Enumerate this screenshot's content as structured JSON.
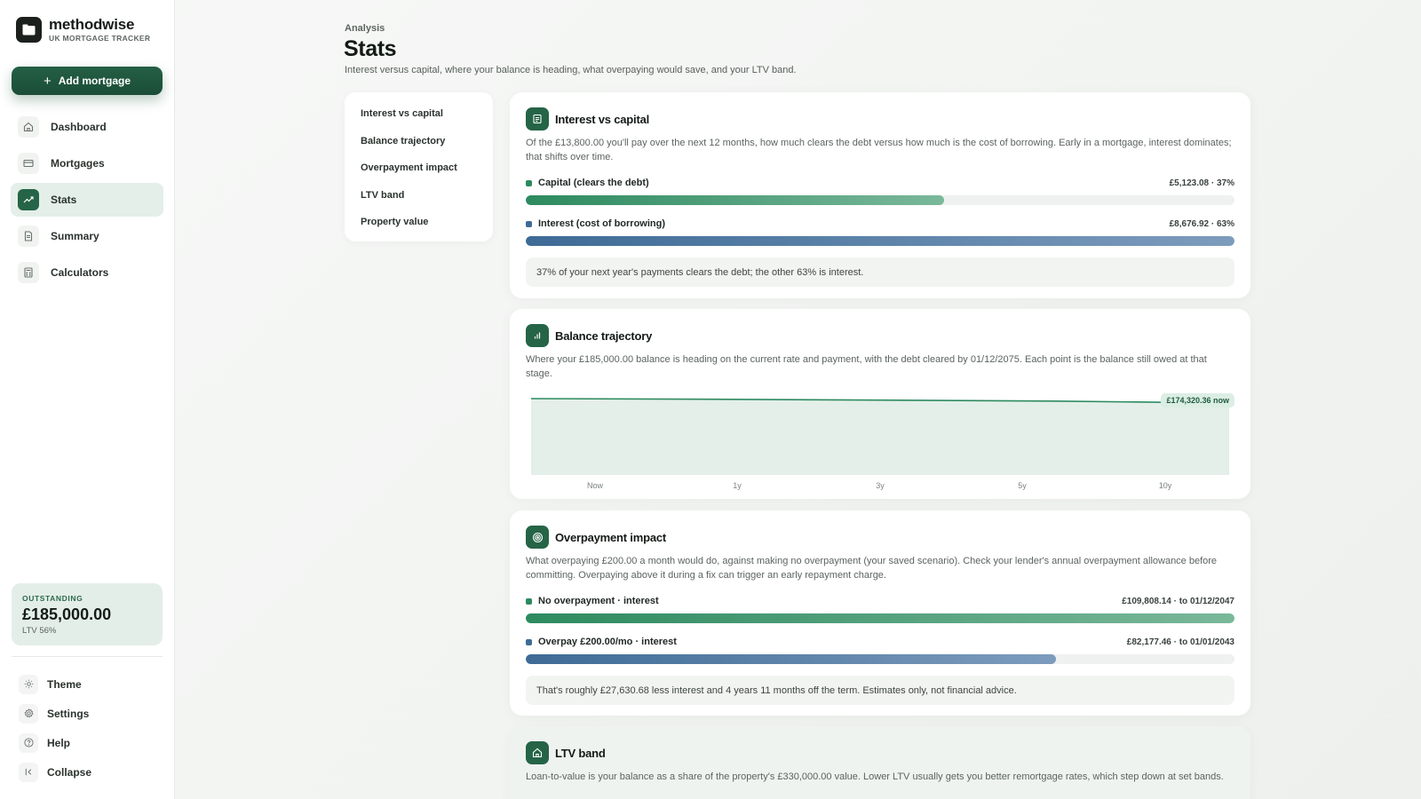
{
  "brand": {
    "name": "methodwise",
    "subtitle": "UK MORTGAGE TRACKER"
  },
  "sidebar": {
    "add_button": "Add mortgage",
    "nav": [
      {
        "label": "Dashboard",
        "icon": "home-icon"
      },
      {
        "label": "Mortgages",
        "icon": "card-icon"
      },
      {
        "label": "Stats",
        "icon": "trend-icon",
        "active": true
      },
      {
        "label": "Summary",
        "icon": "document-icon"
      },
      {
        "label": "Calculators",
        "icon": "calculator-icon"
      }
    ],
    "outstanding": {
      "label": "OUTSTANDING",
      "value": "£185,000.00",
      "ltv": "LTV 56%"
    },
    "footer": [
      {
        "label": "Theme",
        "icon": "sun-icon"
      },
      {
        "label": "Settings",
        "icon": "gear-icon"
      },
      {
        "label": "Help",
        "icon": "help-icon"
      },
      {
        "label": "Collapse",
        "icon": "collapse-icon"
      }
    ]
  },
  "header": {
    "eyebrow": "Analysis",
    "title": "Stats",
    "description": "Interest versus capital, where your balance is heading, what overpaying would save, and your LTV band."
  },
  "section_nav": [
    "Interest vs capital",
    "Balance trajectory",
    "Overpayment impact",
    "LTV band",
    "Property value"
  ],
  "interest_vs_capital": {
    "title": "Interest vs capital",
    "description": "Of the £13,800.00 you'll pay over the next 12 months, how much clears the debt versus how much is the cost of borrowing. Early in a mortgage, interest dominates; that shifts over time.",
    "capital": {
      "label": "Capital (clears the debt)",
      "value": "£5,123.08 · 37%",
      "percent": 37
    },
    "interest": {
      "label": "Interest (cost of borrowing)",
      "value": "£8,676.92 · 63%",
      "percent": 63
    },
    "note": "37% of your next year's payments clears the debt; the other 63% is interest."
  },
  "balance_trajectory": {
    "title": "Balance trajectory",
    "description": "Where your £185,000.00 balance is heading on the current rate and payment, with the debt cleared by 01/12/2075. Each point is the balance still owed at that stage.",
    "badge": "£174,320.36 now"
  },
  "chart_data": {
    "type": "area",
    "categories": [
      "Now",
      "1y",
      "3y",
      "5y",
      "10y"
    ],
    "values": [
      185000,
      183500,
      181500,
      179000,
      174320.36
    ],
    "title": "",
    "xlabel": "",
    "ylabel": "",
    "grid": false,
    "colors": {
      "line": "#2d8a5f",
      "fill": "#e3efe8"
    }
  },
  "overpayment_impact": {
    "title": "Overpayment impact",
    "description": "What overpaying £200.00 a month would do, against making no overpayment (your saved scenario). Check your lender's annual overpayment allowance before committing. Overpaying above it during a fix can trigger an early repayment charge.",
    "no_overpay": {
      "label": "No overpayment · interest",
      "value": "£109,808.14 · to 01/12/2047",
      "fraction": 1.0
    },
    "overpay": {
      "label": "Overpay £200.00/mo · interest",
      "value": "£82,177.46 · to 01/01/2043",
      "fraction": 0.748
    },
    "note": "That's roughly £27,630.68 less interest and 4 years 11 months off the term. Estimates only, not financial advice."
  },
  "ltv_band": {
    "title": "LTV band",
    "description": "Loan-to-value is your balance as a share of the property's £330,000.00 value. Lower LTV usually gets you better remortgage rates, which step down at set bands."
  },
  "colors": {
    "accent": "#256447",
    "capital": "#2d8a5f",
    "interest": "#3e6b96"
  }
}
